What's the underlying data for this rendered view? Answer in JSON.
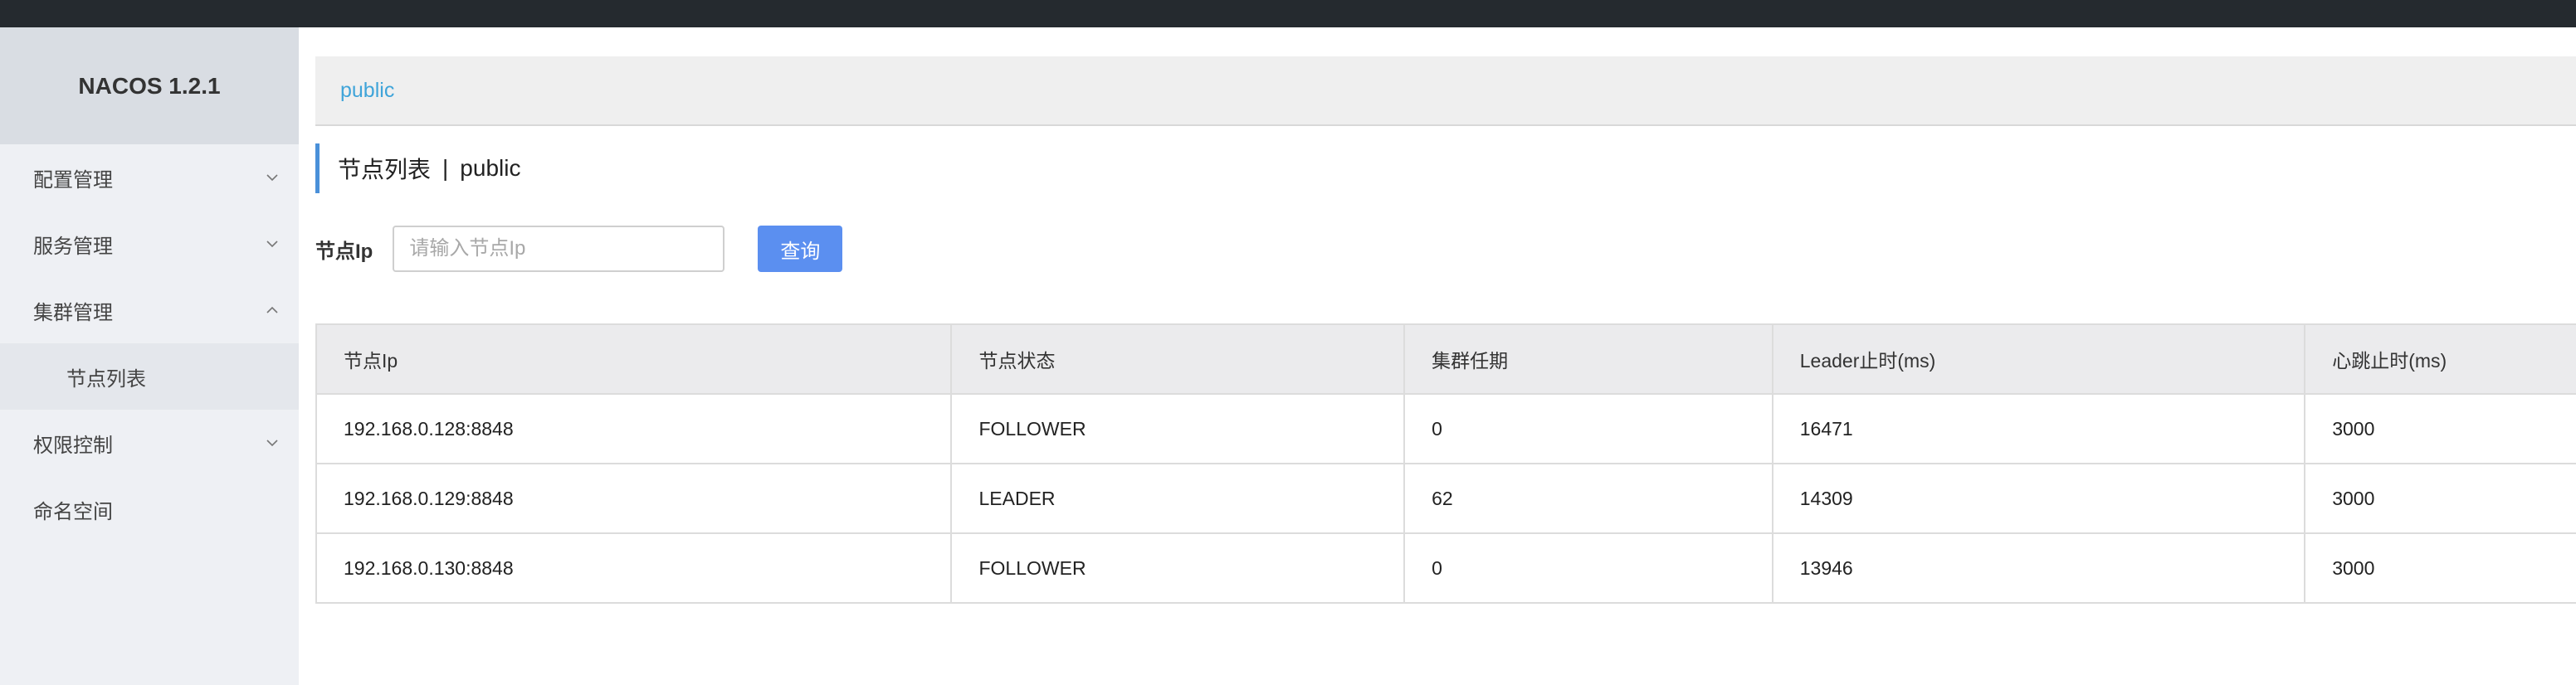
{
  "app": {
    "title": "NACOS 1.2.1"
  },
  "sidebar": {
    "items": [
      {
        "label": "配置管理",
        "icon": "chevron-down-icon"
      },
      {
        "label": "服务管理",
        "icon": "chevron-down-icon"
      },
      {
        "label": "集群管理",
        "icon": "chevron-up-icon",
        "expanded": true,
        "children": [
          {
            "label": "节点列表"
          }
        ]
      },
      {
        "label": "权限控制",
        "icon": "chevron-down-icon"
      },
      {
        "label": "命名空间"
      }
    ]
  },
  "namespace_bar": {
    "label": "public"
  },
  "page": {
    "title": "节点列表",
    "separator": "|",
    "namespace": "public"
  },
  "filter": {
    "label": "节点Ip",
    "placeholder": "请输入节点Ip",
    "value": "",
    "button_label": "查询"
  },
  "table": {
    "headers": [
      "节点Ip",
      "节点状态",
      "集群任期",
      "Leader止时(ms)",
      "心跳止时(ms)"
    ],
    "rows": [
      [
        "192.168.0.128:8848",
        "FOLLOWER",
        "0",
        "16471",
        "3000"
      ],
      [
        "192.168.0.129:8848",
        "LEADER",
        "62",
        "14309",
        "3000"
      ],
      [
        "192.168.0.130:8848",
        "FOLLOWER",
        "0",
        "13946",
        "3000"
      ]
    ]
  },
  "colors": {
    "topbar": "#252a2f",
    "sidebar": "#eef0f4",
    "brand_bg": "#d9dde3",
    "accent": "#5b8ff0",
    "link": "#3fa4d9",
    "title_bar": "#4a90d9"
  }
}
